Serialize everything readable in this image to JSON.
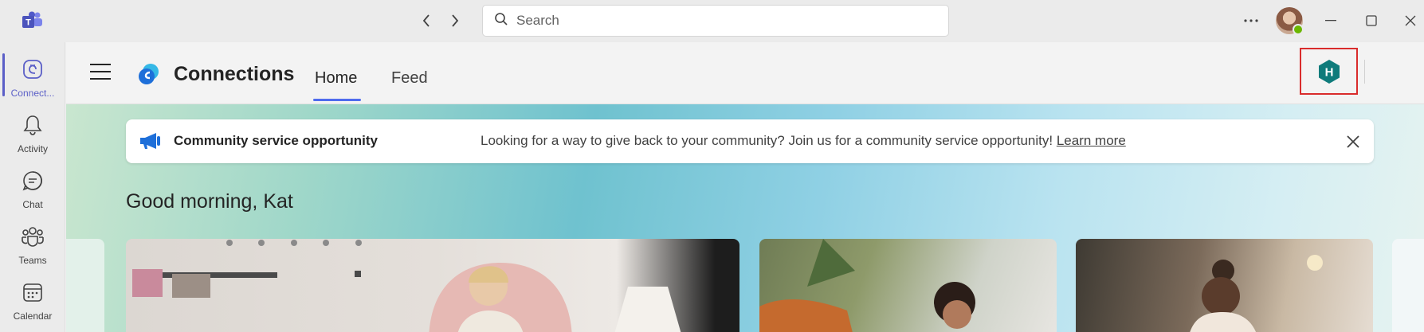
{
  "titlebar": {
    "search_placeholder": "Search"
  },
  "rail": {
    "items": [
      {
        "label": "Connect...",
        "icon": "connections-icon"
      },
      {
        "label": "Activity",
        "icon": "bell-icon"
      },
      {
        "label": "Chat",
        "icon": "chat-icon"
      },
      {
        "label": "Teams",
        "icon": "teams-icon"
      },
      {
        "label": "Calendar",
        "icon": "calendar-icon"
      }
    ]
  },
  "header": {
    "app_title": "Connections",
    "tabs": [
      {
        "label": "Home"
      },
      {
        "label": "Feed"
      }
    ],
    "home_site_initial": "H"
  },
  "banner": {
    "title": "Community service opportunity",
    "text": "Looking for a way to give back to your community? Join us for a community service opportunity! ",
    "link": "Learn more"
  },
  "greeting": "Good morning, Kat",
  "colors": {
    "accent": "#5b5fc7",
    "tab_underline": "#4f6bed",
    "highlight_frame": "#d92c2c",
    "home_icon": "#0f7b7b"
  }
}
